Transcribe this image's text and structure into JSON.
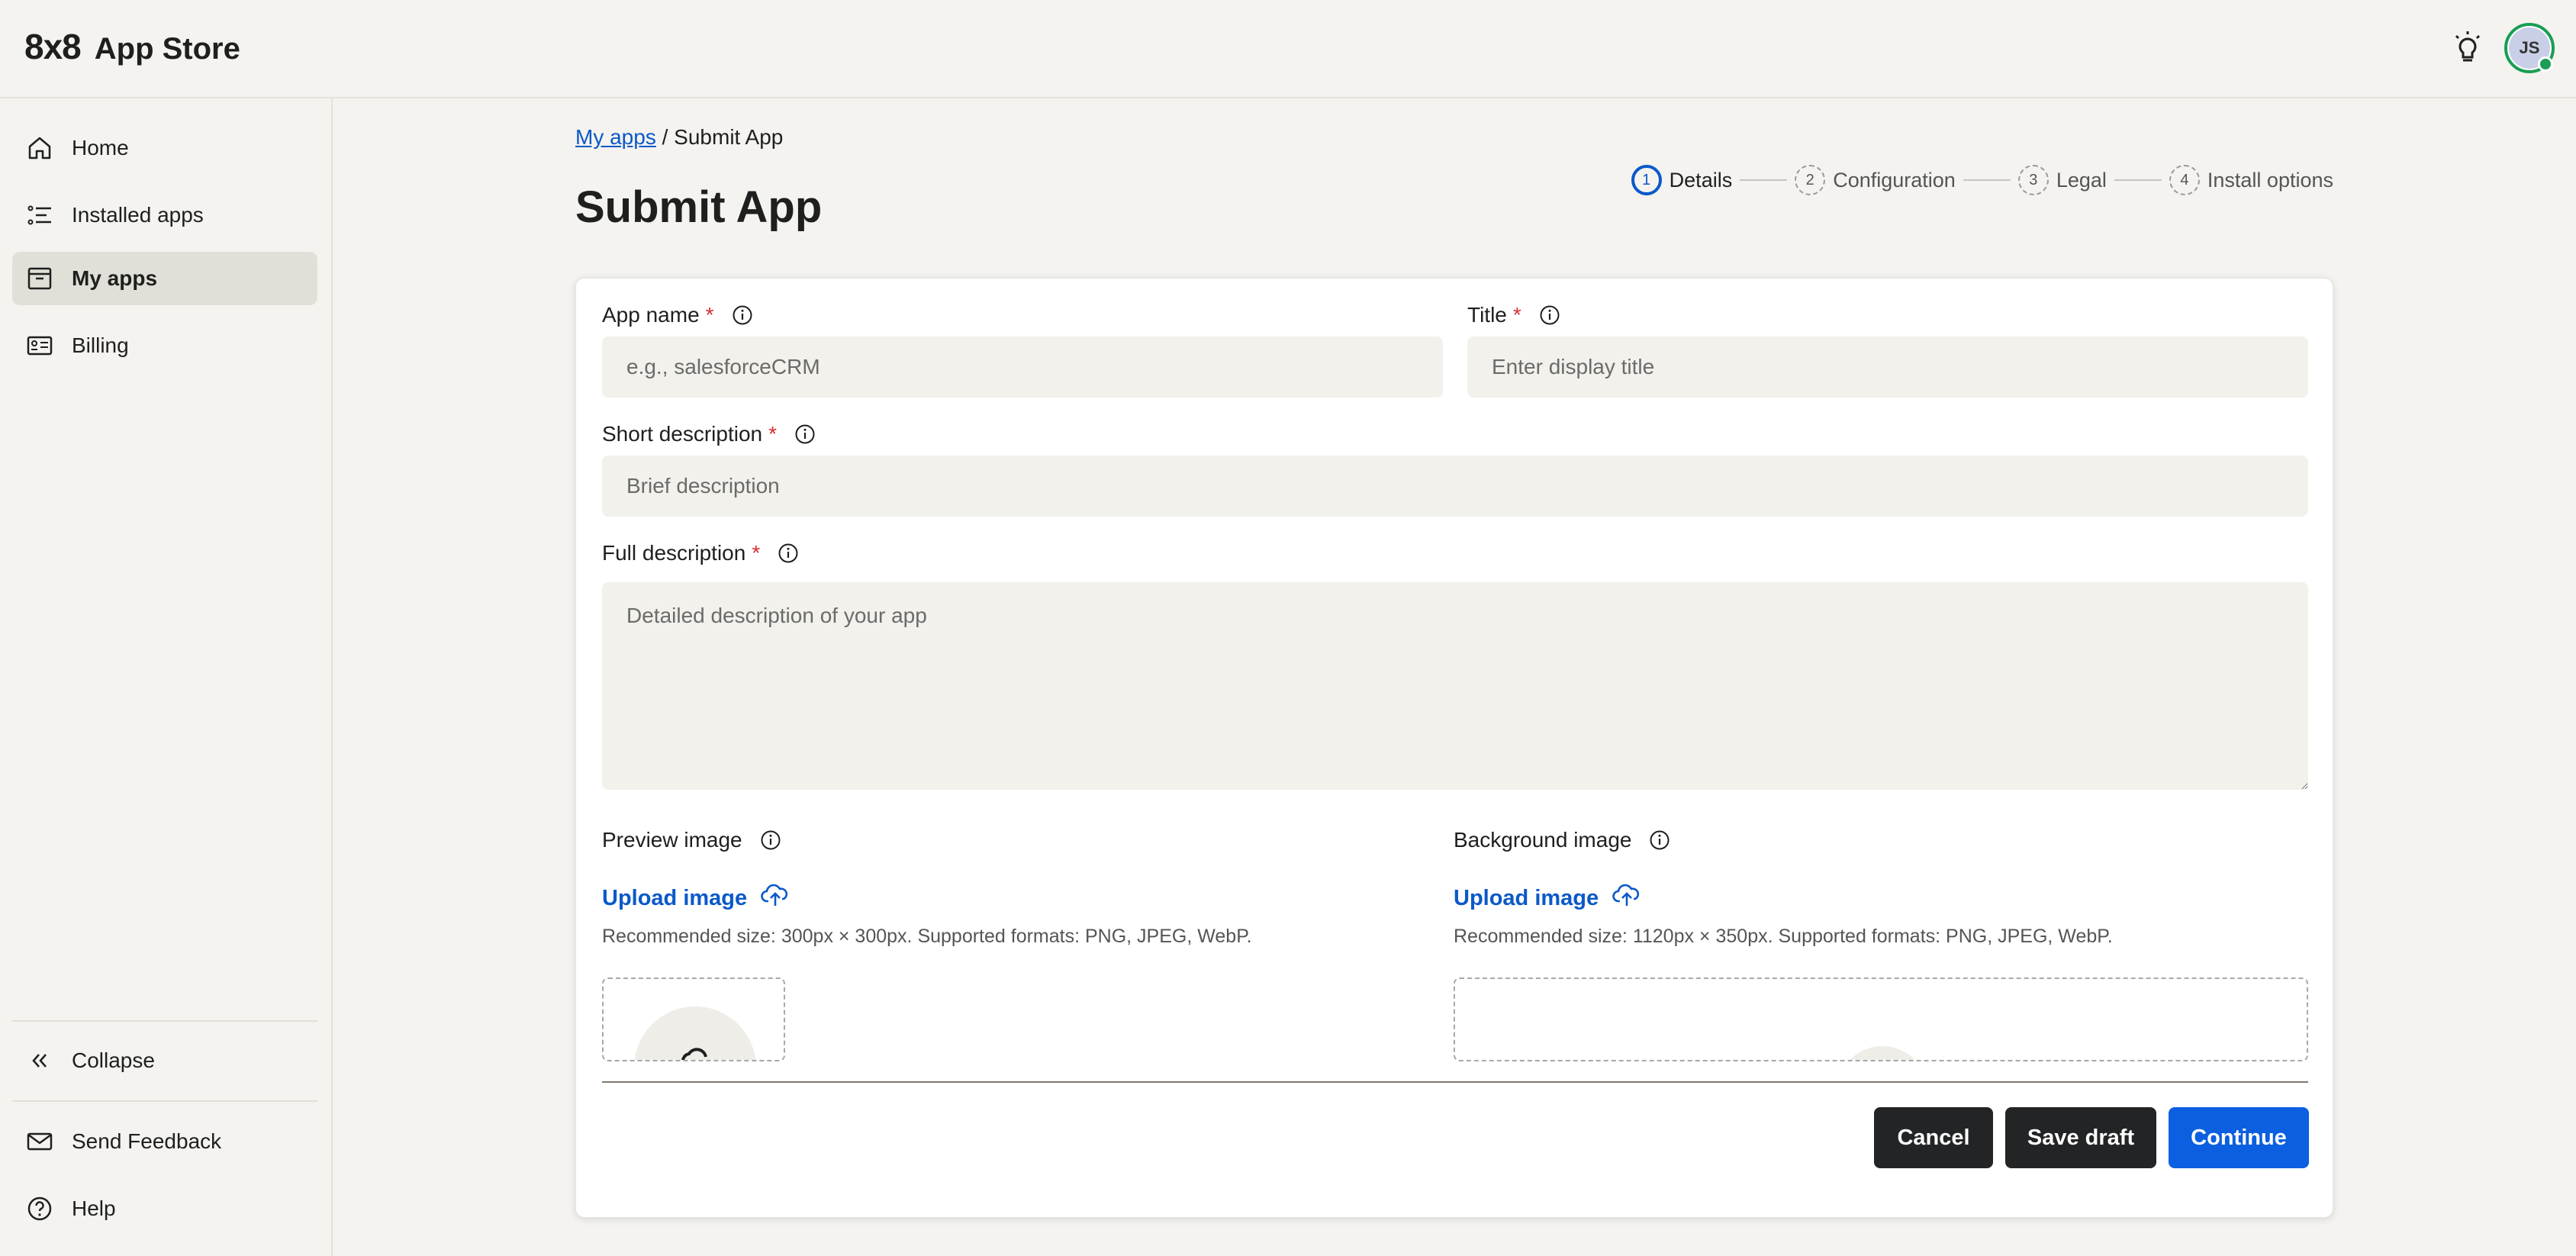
{
  "app": {
    "logo": "8x8",
    "name": "App Store",
    "user_initials": "JS"
  },
  "sidebar": {
    "items": [
      {
        "label": "Home",
        "icon": "home-icon"
      },
      {
        "label": "Installed apps",
        "icon": "list-icon"
      },
      {
        "label": "My apps",
        "icon": "archive-box-icon",
        "active": true
      },
      {
        "label": "Billing",
        "icon": "billing-card-icon"
      }
    ],
    "collapse_label": "Collapse",
    "feedback_label": "Send Feedback",
    "help_label": "Help"
  },
  "breadcrumb": {
    "parent": "My apps",
    "separator": "/",
    "current": "Submit App"
  },
  "page": {
    "title": "Submit App"
  },
  "stepper": {
    "steps": [
      {
        "num": "1",
        "label": "Details",
        "active": true
      },
      {
        "num": "2",
        "label": "Configuration"
      },
      {
        "num": "3",
        "label": "Legal"
      },
      {
        "num": "4",
        "label": "Install options"
      }
    ]
  },
  "form": {
    "required_mark": "*",
    "app_name": {
      "label": "App name",
      "placeholder": "e.g., salesforceCRM",
      "value": ""
    },
    "title": {
      "label": "Title",
      "placeholder": "Enter display title",
      "value": ""
    },
    "short_description": {
      "label": "Short description",
      "placeholder": "Brief description",
      "value": ""
    },
    "full_description": {
      "label": "Full description",
      "placeholder": "Detailed description of your app",
      "value": ""
    },
    "preview_image": {
      "label": "Preview image",
      "upload_label": "Upload image",
      "hint": "Recommended size: 300px × 300px. Supported formats: PNG, JPEG, WebP."
    },
    "background_image": {
      "label": "Background image",
      "upload_label": "Upload image",
      "hint": "Recommended size: 1120px × 350px. Supported formats: PNG, JPEG, WebP."
    }
  },
  "actions": {
    "cancel_label": "Cancel",
    "save_draft_label": "Save draft",
    "continue_label": "Continue"
  },
  "colors": {
    "accent": "#0b5fe0",
    "link": "#0b59c9",
    "required": "#d62f2f",
    "online_status": "#1a9e55",
    "dark_button": "#222426"
  }
}
